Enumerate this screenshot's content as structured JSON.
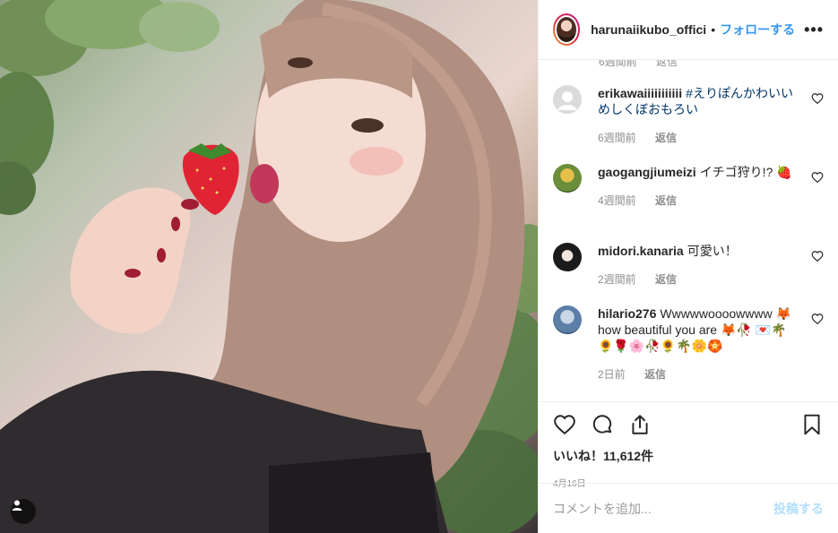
{
  "header": {
    "username": "harunaiikubo_offici",
    "separator": "•",
    "follow_label": "フォローする",
    "more_label": "•••"
  },
  "partial_comment_meta": {
    "time": "6週間前",
    "reply": "返信"
  },
  "comments": [
    {
      "user": "erikawaiiiiiiiiiii",
      "text_tag": "#えりぽんかわいいめしくぼおもろい",
      "text": "",
      "time": "6週間前",
      "reply": "返信"
    },
    {
      "user": "gaogangjiumeizi",
      "text": "イチゴ狩り!? 🍓",
      "time": "4週間前",
      "reply": "返信"
    },
    {
      "user": "midori.kanaria",
      "text": "可愛い！",
      "time": "2週間前",
      "reply": "返信"
    },
    {
      "user": "hilario276",
      "text": "Wwwwwoooowwww 🦊 how beautiful you are 🦊🥀 💌🌴🌻🌹🌸🥀🌻🌴🌼🏵️",
      "time": "2日前",
      "reply": "返信"
    }
  ],
  "likes": {
    "label": "いいね！",
    "count": "11,612件"
  },
  "post_date": "4月16日",
  "add_comment": {
    "placeholder": "コメントを追加...",
    "post_label": "投稿する"
  },
  "icons": {
    "like": "heart-icon",
    "comment": "comment-bubble-icon",
    "share": "share-icon",
    "save": "bookmark-icon",
    "tag": "user-tag-icon",
    "comment_like": "small-heart-icon"
  },
  "colors": {
    "accent": "#3897f0",
    "muted": "#8e8e8e",
    "text": "#262626",
    "post_disabled": "#b2dffc"
  }
}
